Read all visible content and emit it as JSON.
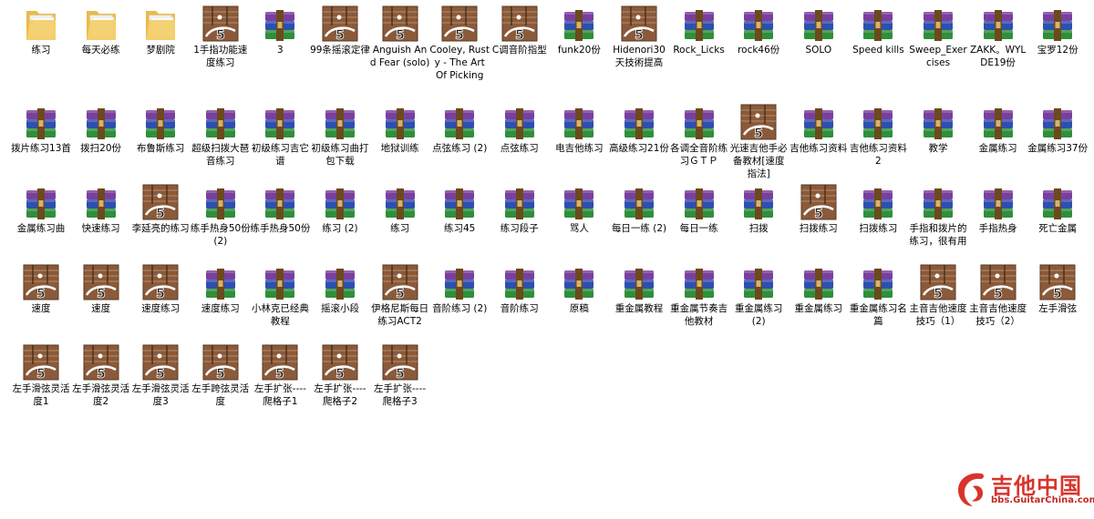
{
  "rows": [
    [
      {
        "label": "练习",
        "icon": "folder-icon"
      },
      {
        "label": "每天必练",
        "icon": "folder-icon"
      },
      {
        "label": "梦剧院",
        "icon": "folder-icon"
      },
      {
        "label": "1手指功能速度练习",
        "icon": "guitar-pro-file-icon"
      },
      {
        "label": "3",
        "icon": "rar-archive-icon"
      },
      {
        "label": "99条摇滚定律",
        "icon": "guitar-pro-file-icon"
      },
      {
        "label": "Anguish And Fear (solo)",
        "icon": "guitar-pro-file-icon"
      },
      {
        "label": "Cooley, Rusty - The Art Of Picking",
        "icon": "guitar-pro-file-icon"
      },
      {
        "label": "C调音阶指型",
        "icon": "guitar-pro-file-icon"
      },
      {
        "label": "funk20份",
        "icon": "rar-archive-icon"
      },
      {
        "label": "Hidenori30天技術提高",
        "icon": "guitar-pro-file-icon"
      },
      {
        "label": "Rock_Licks",
        "icon": "rar-archive-icon"
      },
      {
        "label": "rock46份",
        "icon": "rar-archive-icon"
      },
      {
        "label": "SOLO",
        "icon": "rar-archive-icon"
      },
      {
        "label": "Speed kills",
        "icon": "rar-archive-icon"
      },
      {
        "label": "Sweep_Exercises",
        "icon": "rar-archive-icon"
      },
      {
        "label": "ZAKK。WYLDE19份",
        "icon": "rar-archive-icon"
      },
      {
        "label": "宝罗12份",
        "icon": "rar-archive-icon"
      }
    ],
    [
      {
        "label": "拨片练习13首",
        "icon": "rar-archive-icon"
      },
      {
        "label": "拨扫20份",
        "icon": "rar-archive-icon"
      },
      {
        "label": "布鲁斯练习",
        "icon": "rar-archive-icon"
      },
      {
        "label": "超级扫拨大琶音练习",
        "icon": "rar-archive-icon"
      },
      {
        "label": "初级练习吉它谱",
        "icon": "rar-archive-icon"
      },
      {
        "label": "初级练习曲打包下载",
        "icon": "rar-archive-icon"
      },
      {
        "label": "地狱训练",
        "icon": "rar-archive-icon"
      },
      {
        "label": "点弦练习 (2)",
        "icon": "rar-archive-icon"
      },
      {
        "label": "点弦练习",
        "icon": "rar-archive-icon"
      },
      {
        "label": "电吉他练习",
        "icon": "rar-archive-icon"
      },
      {
        "label": "高级练习21份",
        "icon": "rar-archive-icon"
      },
      {
        "label": "各调全音阶练习ＧＴＰ",
        "icon": "rar-archive-icon"
      },
      {
        "label": "光速吉他手必备教材[速度指法]",
        "icon": "guitar-pro-file-icon"
      },
      {
        "label": "吉他练习资料",
        "icon": "rar-archive-icon"
      },
      {
        "label": "吉他练习资料2",
        "icon": "rar-archive-icon"
      },
      {
        "label": "教学",
        "icon": "rar-archive-icon"
      },
      {
        "label": "金属练习",
        "icon": "rar-archive-icon"
      },
      {
        "label": "金属练习37份",
        "icon": "rar-archive-icon"
      }
    ],
    [
      {
        "label": "金属练习曲",
        "icon": "rar-archive-icon"
      },
      {
        "label": "快速练习",
        "icon": "rar-archive-icon"
      },
      {
        "label": "李延亮的练习",
        "icon": "guitar-pro-file-icon"
      },
      {
        "label": "练手热身50份 (2)",
        "icon": "rar-archive-icon"
      },
      {
        "label": "练手热身50份",
        "icon": "rar-archive-icon"
      },
      {
        "label": "练习 (2)",
        "icon": "rar-archive-icon"
      },
      {
        "label": "练习",
        "icon": "rar-archive-icon"
      },
      {
        "label": "练习45",
        "icon": "rar-archive-icon"
      },
      {
        "label": "练习段子",
        "icon": "rar-archive-icon"
      },
      {
        "label": "骂人",
        "icon": "rar-archive-icon"
      },
      {
        "label": "每日一练 (2)",
        "icon": "rar-archive-icon"
      },
      {
        "label": "每日一练",
        "icon": "rar-archive-icon"
      },
      {
        "label": "扫拨",
        "icon": "rar-archive-icon"
      },
      {
        "label": "扫拨练习",
        "icon": "guitar-pro-file-icon"
      },
      {
        "label": "扫拨练习",
        "icon": "rar-archive-icon"
      },
      {
        "label": "手指和拨片的练习，很有用",
        "icon": "rar-archive-icon"
      },
      {
        "label": "手指热身",
        "icon": "rar-archive-icon"
      },
      {
        "label": "死亡金属",
        "icon": "rar-archive-icon"
      }
    ],
    [
      {
        "label": "速度",
        "icon": "guitar-pro-file-icon"
      },
      {
        "label": "速度",
        "icon": "guitar-pro-file-icon"
      },
      {
        "label": "速度练习",
        "icon": "guitar-pro-file-icon"
      },
      {
        "label": "速度练习",
        "icon": "rar-archive-icon"
      },
      {
        "label": "小林克已经典教程",
        "icon": "rar-archive-icon"
      },
      {
        "label": "摇滚小段",
        "icon": "rar-archive-icon"
      },
      {
        "label": "伊格尼斯每日练习ACT2",
        "icon": "guitar-pro-file-icon"
      },
      {
        "label": "音阶练习 (2)",
        "icon": "rar-archive-icon"
      },
      {
        "label": "音阶练习",
        "icon": "rar-archive-icon"
      },
      {
        "label": "原稿",
        "icon": "rar-archive-icon"
      },
      {
        "label": "重金属教程",
        "icon": "rar-archive-icon"
      },
      {
        "label": "重金属节奏吉他教材",
        "icon": "rar-archive-icon"
      },
      {
        "label": "重金属练习 (2)",
        "icon": "rar-archive-icon"
      },
      {
        "label": "重金属练习",
        "icon": "rar-archive-icon"
      },
      {
        "label": "重金属练习名篇",
        "icon": "rar-archive-icon"
      },
      {
        "label": "主音吉他速度技巧（1）",
        "icon": "guitar-pro-file-icon"
      },
      {
        "label": "主音吉他速度技巧（2）",
        "icon": "guitar-pro-file-icon"
      },
      {
        "label": "左手滑弦",
        "icon": "guitar-pro-file-icon"
      }
    ],
    [
      {
        "label": "左手滑弦灵活度1",
        "icon": "guitar-pro-file-icon"
      },
      {
        "label": "左手滑弦灵活度2",
        "icon": "guitar-pro-file-icon"
      },
      {
        "label": "左手滑弦灵活度3",
        "icon": "guitar-pro-file-icon"
      },
      {
        "label": "左手跨弦灵活度",
        "icon": "guitar-pro-file-icon"
      },
      {
        "label": "左手扩张----爬格子1",
        "icon": "guitar-pro-file-icon"
      },
      {
        "label": "左手扩张----爬格子2",
        "icon": "guitar-pro-file-icon"
      },
      {
        "label": "左手扩张----爬格子3",
        "icon": "guitar-pro-file-icon"
      }
    ]
  ],
  "watermark": {
    "title": "吉他中国",
    "url": "bbs.GuitarChina.com",
    "icon": "guitarchina-logo-icon"
  },
  "colors": {
    "folder": "#f3cf6a",
    "rar_purple": "#7a3f9e",
    "rar_blue": "#2e4fae",
    "rar_green": "#2f8f3a",
    "rar_strap": "#6b4a1e",
    "gp_wood": "#8a5a3a",
    "watermark_red": "#d9342b"
  }
}
